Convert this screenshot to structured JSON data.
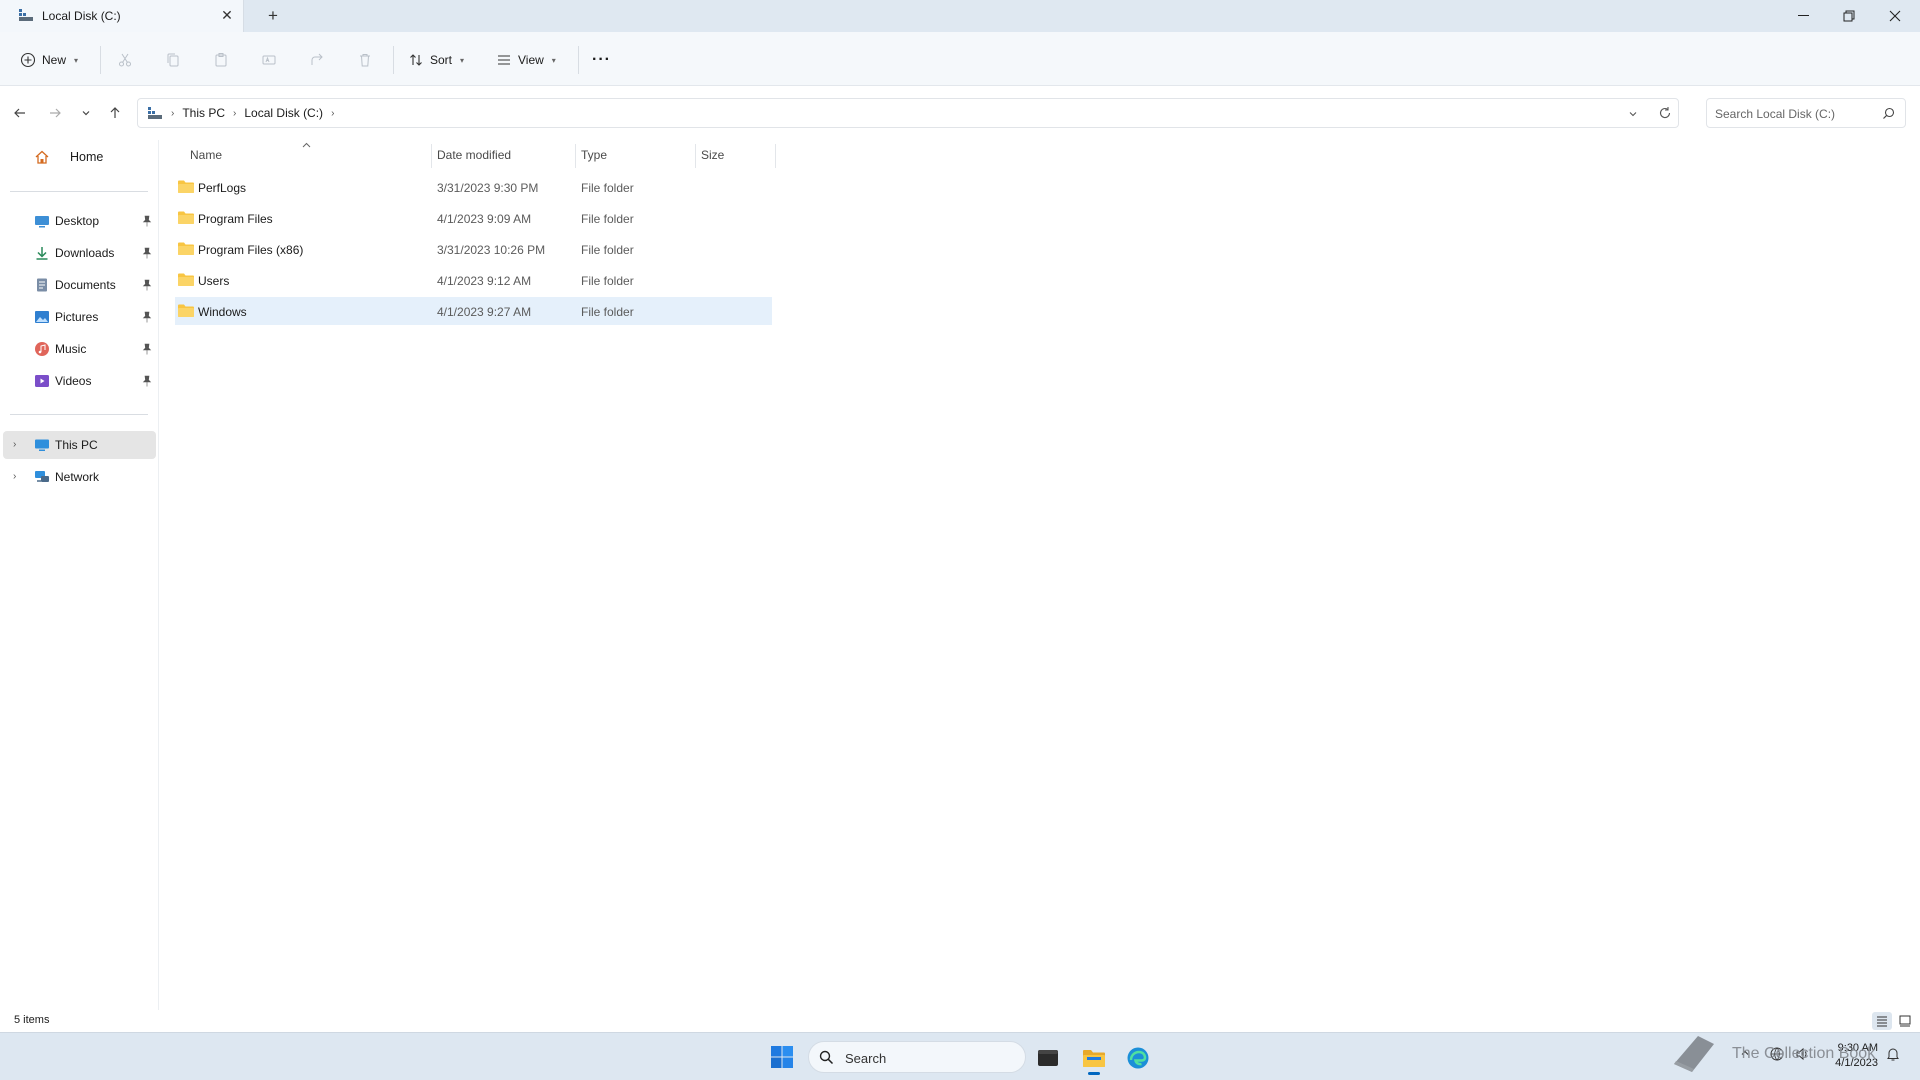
{
  "window": {
    "tab_title": "Local Disk (C:)",
    "new_tab_label": "+"
  },
  "toolbar": {
    "new_label": "New",
    "sort_label": "Sort",
    "view_label": "View",
    "more_label": "···"
  },
  "address": {
    "crumbs": [
      "This PC",
      "Local Disk (C:)"
    ],
    "search_placeholder": "Search Local Disk (C:)"
  },
  "sidebar": {
    "home": "Home",
    "quick_access": [
      {
        "label": "Desktop",
        "icon": "desktop-icon",
        "pinned": true
      },
      {
        "label": "Downloads",
        "icon": "download-icon",
        "pinned": true
      },
      {
        "label": "Documents",
        "icon": "documents-icon",
        "pinned": true
      },
      {
        "label": "Pictures",
        "icon": "pictures-icon",
        "pinned": true
      },
      {
        "label": "Music",
        "icon": "music-icon",
        "pinned": true
      },
      {
        "label": "Videos",
        "icon": "videos-icon",
        "pinned": true
      }
    ],
    "this_pc": "This PC",
    "network": "Network"
  },
  "columns": {
    "name": "Name",
    "date": "Date modified",
    "type": "Type",
    "size": "Size"
  },
  "files": [
    {
      "name": "PerfLogs",
      "date": "3/31/2023 9:30 PM",
      "type": "File folder",
      "size": ""
    },
    {
      "name": "Program Files",
      "date": "4/1/2023 9:09 AM",
      "type": "File folder",
      "size": ""
    },
    {
      "name": "Program Files (x86)",
      "date": "3/31/2023 10:26 PM",
      "type": "File folder",
      "size": ""
    },
    {
      "name": "Users",
      "date": "4/1/2023 9:12 AM",
      "type": "File folder",
      "size": ""
    },
    {
      "name": "Windows",
      "date": "4/1/2023 9:27 AM",
      "type": "File folder",
      "size": ""
    }
  ],
  "status": {
    "item_count": "5 items"
  },
  "taskbar": {
    "search_label": "Search",
    "time": "9:30 AM",
    "date": "4/1/2023"
  },
  "watermark": {
    "text": "The Collection Book"
  },
  "colors": {
    "accent": "#0067c0",
    "folder": "#f8c542",
    "selection": "#e5f0fb"
  }
}
